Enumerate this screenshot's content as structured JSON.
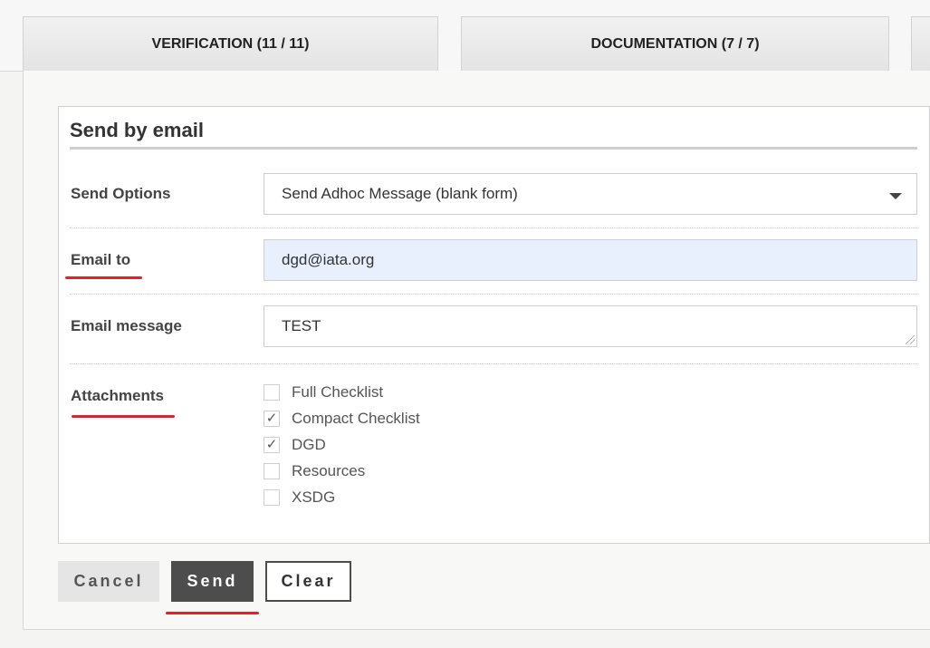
{
  "tabs": [
    {
      "label": "VERIFICATION (11 / 11)"
    },
    {
      "label": "DOCUMENTATION (7 / 7)"
    }
  ],
  "form": {
    "title": "Send by email",
    "send_options": {
      "label": "Send Options",
      "value": "Send Adhoc Message (blank form)"
    },
    "email_to": {
      "label": "Email to",
      "value": "dgd@iata.org"
    },
    "email_message": {
      "label": "Email message",
      "value": "TEST"
    },
    "attachments": {
      "label": "Attachments",
      "items": [
        {
          "label": "Full Checklist",
          "checked": false,
          "mark": ""
        },
        {
          "label": "Compact Checklist",
          "checked": true,
          "mark": "✓"
        },
        {
          "label": "DGD",
          "checked": true,
          "mark": "✓"
        },
        {
          "label": "Resources",
          "checked": false,
          "mark": ""
        },
        {
          "label": "XSDG",
          "checked": false,
          "mark": ""
        }
      ]
    }
  },
  "buttons": {
    "cancel": "Cancel",
    "send": "Send",
    "clear": "Clear"
  },
  "colors": {
    "highlight_underline": "#d8262a",
    "autofill_bg": "#e8f0fe",
    "primary_button": "#4d4d4d"
  }
}
